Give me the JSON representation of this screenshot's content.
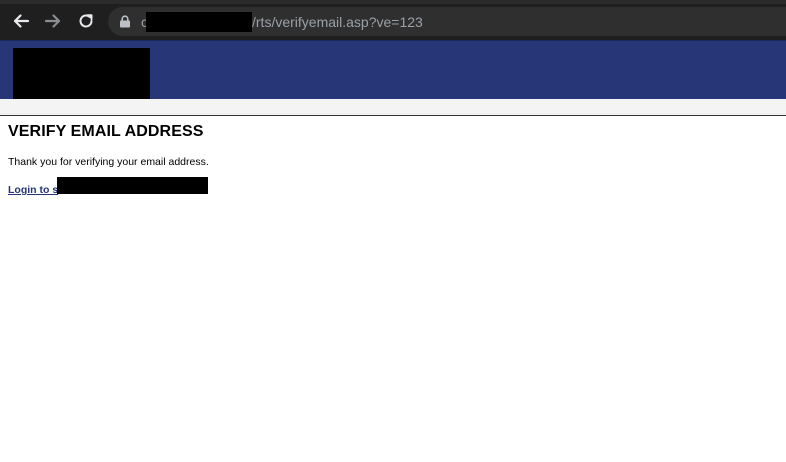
{
  "browser": {
    "url_tail": "/rts/verifyemail.asp?ve=123",
    "url_lead": "c",
    "icons": {
      "back": "arrow-left-icon",
      "forward": "arrow-right-icon",
      "reload": "reload-icon",
      "lock": "lock-icon"
    }
  },
  "page": {
    "title": "VERIFY EMAIL ADDRESS",
    "message": "Thank you for verifying your email address.",
    "login_link": "Login to s"
  },
  "colors": {
    "header_bg": "#263677",
    "chrome_bg": "#1f1f1f",
    "link": "#263677"
  }
}
